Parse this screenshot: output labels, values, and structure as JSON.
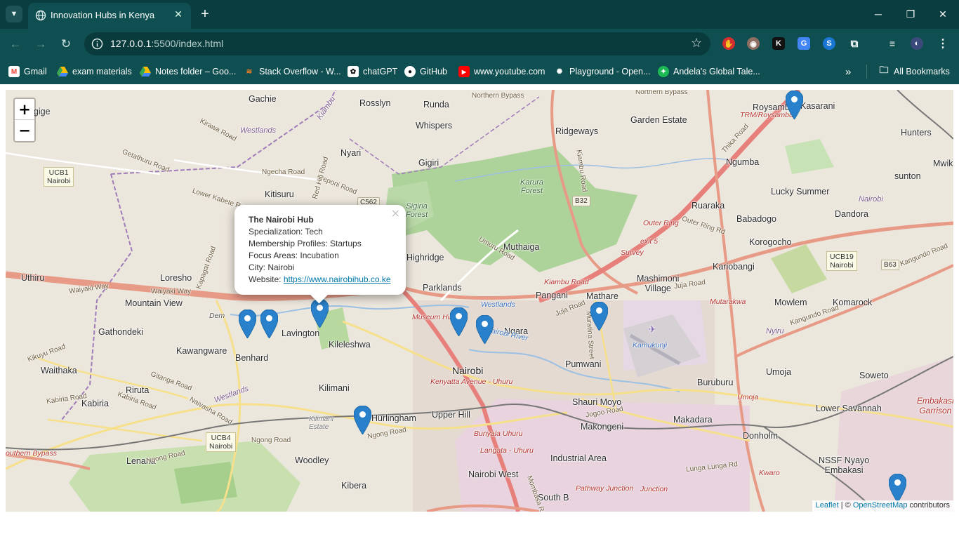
{
  "browser": {
    "tab": {
      "title": "Innovation Hubs in Kenya"
    },
    "url": {
      "host": "127.0.0.1",
      "path": ":5500/index.html"
    },
    "bookmarks": [
      {
        "label": "Gmail",
        "icon": "gmail-icon"
      },
      {
        "label": "exam materials",
        "icon": "google-drive-icon"
      },
      {
        "label": "Notes folder – Goo...",
        "icon": "google-drive-icon"
      },
      {
        "label": "Stack Overflow - W...",
        "icon": "stackoverflow-icon"
      },
      {
        "label": "chatGPT",
        "icon": "chatgpt-icon"
      },
      {
        "label": "GitHub",
        "icon": "github-icon"
      },
      {
        "label": "www.youtube.com",
        "icon": "youtube-icon"
      },
      {
        "label": "Playground - Open...",
        "icon": "openai-icon"
      },
      {
        "label": "Andela's Global Tale...",
        "icon": "andela-icon"
      }
    ],
    "all_bookmarks": "All Bookmarks"
  },
  "map": {
    "zoom_in": "+",
    "zoom_out": "−",
    "popup": {
      "name": "The Nairobi Hub",
      "specialization": "Specialization: Tech",
      "membership": "Membership Profiles: Startups",
      "focus": "Focus Areas: Incubation",
      "city": "City: Nairobi",
      "website_prefix": "Website: ",
      "website": "https://www.nairobihub.co.ke",
      "close": "×"
    },
    "attribution": {
      "leaflet": "Leaflet",
      "sep": " | © ",
      "osm": "OpenStreetMap",
      "suffix": " contributors"
    },
    "places": {
      "gachie": "Gachie",
      "rosslyn": "Rosslyn",
      "runda": "Runda",
      "whispers": "Whispers",
      "ridgeways": "Ridgeways",
      "garden_estate": "Garden Estate",
      "roysambu": "Roysambu",
      "kasarani": "Kasarani",
      "hunters": "Hunters",
      "mwiki": "Mwik",
      "kangige": "angige",
      "nyari": "Nyari",
      "gigiri": "Gigiri",
      "ngumba": "Ngumba",
      "sunton": "sunton",
      "kitisuru": "Kitisuru",
      "karura_forest": "Karura\nForest",
      "lucky_summer": "Lucky Summer",
      "ruaraka": "Ruaraka",
      "dandora": "Dandora",
      "babadogo": "Babadogo",
      "korogocho": "Korogocho",
      "sigiria_forest": "Sigiria\nForest",
      "muthaiga": "Muthaiga",
      "highridge": "Highridge",
      "uthiru": "Uthiru",
      "loresho": "Loresho",
      "mountain_view": "Mountain View",
      "parklands": "Parklands",
      "kariobangi": "Kariobangi",
      "mashimoni": "Mashimoni\nVillage",
      "pangani": "Pangani",
      "mathare": "Mathare",
      "mowlem": "Mowlem",
      "komarock": "Komarock",
      "lavington": "Lavington",
      "kileleshwa": "Kileleshwa",
      "gathondeki": "Gathondeki",
      "ngara": "Ngara",
      "kawangware": "Kawangware",
      "benhard": "Benhard",
      "waithaka": "Waithaka",
      "nairobi": "Nairobi",
      "pumwani": "Pumwani",
      "umoja": "Umoja",
      "soweto": "Soweto",
      "riruta": "Riruta",
      "kilimani": "Kilimani",
      "buruburu": "Buruburu",
      "kabiria": "Kabiria",
      "shauri_moyo": "Shauri Moyo",
      "lower_savannah": "Lower Savannah",
      "upper_hill": "Upper Hill",
      "hurlingham": "Hurlingham",
      "kilimani_estate": "Kilimani\nEstate",
      "makongeni": "Makongeni",
      "makadara": "Makadara",
      "donholm": "Donholm",
      "embakasi": "Embakasi\nGarrison",
      "lenana": "Lenana",
      "woodley": "Woodley",
      "industrial_area": "Industrial Area",
      "nssf": "NSSF Nyayo\nEmbakasi",
      "kibera": "Kibera",
      "nairobi_west": "Nairobi West",
      "south_b": "South B",
      "dem": "Dem"
    },
    "roads": {
      "northern_bypass": "Northern Bypass",
      "northern_bypass2": "Northern Bypass",
      "kirawa": "Kirawa Road",
      "getathuru": "Getathuru Road",
      "ngecha": "Ngecha Road",
      "peponi": "Peponi Road",
      "red_hill": "Red Hill Road",
      "lower_kabete": "Lower Kabete Road",
      "kiambu_road": "Kiambu Road",
      "thika_road": "Thika Road",
      "waiyaki": "Waiyaki Way",
      "waiyaki2": "Waiyaki Way",
      "kapagat": "Kapagat Road",
      "umuru": "Umuru Road",
      "kiambu_rd_red": "Kiambu Road",
      "outer_ring": "Outer Ring",
      "outer_ring_rd": "Outer Ring Rd",
      "kangundo": "Kangundo Road",
      "kangundo2": "Kangundo Road",
      "juja_road": "Juja Road",
      "juja2": "Juja Road",
      "museum_hill": "Museum Hill",
      "kenyatta": "Kenyatta Avenue - Uhuru",
      "jogoo": "Jogoo Road",
      "ngong_road": "Ngong Road",
      "ngong2": "Ngong Road",
      "ngong3": "Ngong Road",
      "kikuyu": "Kikuyu Road",
      "gitanga": "Gitanga Road",
      "kabiria_road": "Kabiria Road",
      "kabiria2": "Kabiria Road",
      "naivasha": "Naivasha Road",
      "lunga": "Lunga Lunga Rd",
      "bunyala": "Bunyala Uhuru",
      "langata": "Langata - Uhuru",
      "pathway": "Pathway Junction",
      "junction": "Junction",
      "mombasa": "Mombasa Road",
      "mutarakwa": "Mutarakwa",
      "kwaro": "Kwaro",
      "umoja_rd": "Umoja",
      "survey": "Survey",
      "exit5": "exit 5",
      "trm": "TRM/Roysambu",
      "southern_bypass": "outhern Bypass",
      "mumias": "Muratina Street"
    },
    "water": {
      "nairobi_river": "Nairobi River",
      "westlands_river": "Westlands",
      "kamukunji": "Kamukunji"
    },
    "admin": {
      "westlands": "Westlands",
      "kiambu": "Kiambu",
      "westlands2": "Westlands",
      "westlands3": "Westlands",
      "nairobi_r": "Nairobi",
      "nyiru": "Nyiru"
    },
    "shields": {
      "c562": "C562",
      "b32": "B32",
      "b63": "B63"
    },
    "ucb": {
      "ucb1": "UCB1\nNairobi",
      "ucb19": "UCB19\nNairobi",
      "ucb4": "UCB4\nNairobi"
    }
  }
}
